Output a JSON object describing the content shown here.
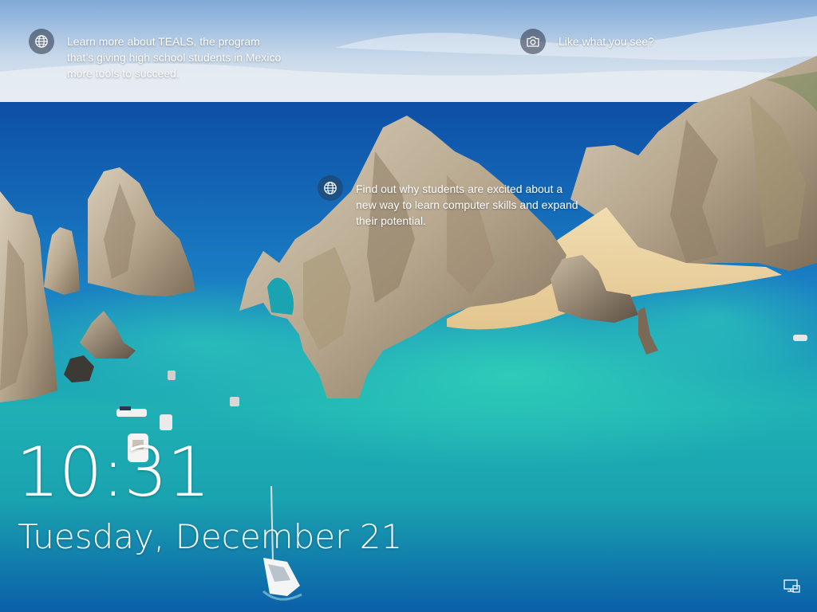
{
  "lock_screen": {
    "clock": "10:31",
    "date": "Tuesday, December 21"
  },
  "spotlight": {
    "hotspot_teals": {
      "icon": "globe-icon",
      "text": "Learn more about TEALS, the program that’s giving high school students in Mexico more tools to succeed."
    },
    "like_prompt": {
      "icon": "camera-icon",
      "text": "Like what you see?"
    },
    "hotspot_students": {
      "icon": "globe-icon",
      "text": "Find out why students are excited about a new way to learn computer skills and expand their potential."
    }
  },
  "system_tray": {
    "network_icon": "network-icon"
  },
  "colors": {
    "text": "#ffffff",
    "icon_bubble": "#283246"
  }
}
